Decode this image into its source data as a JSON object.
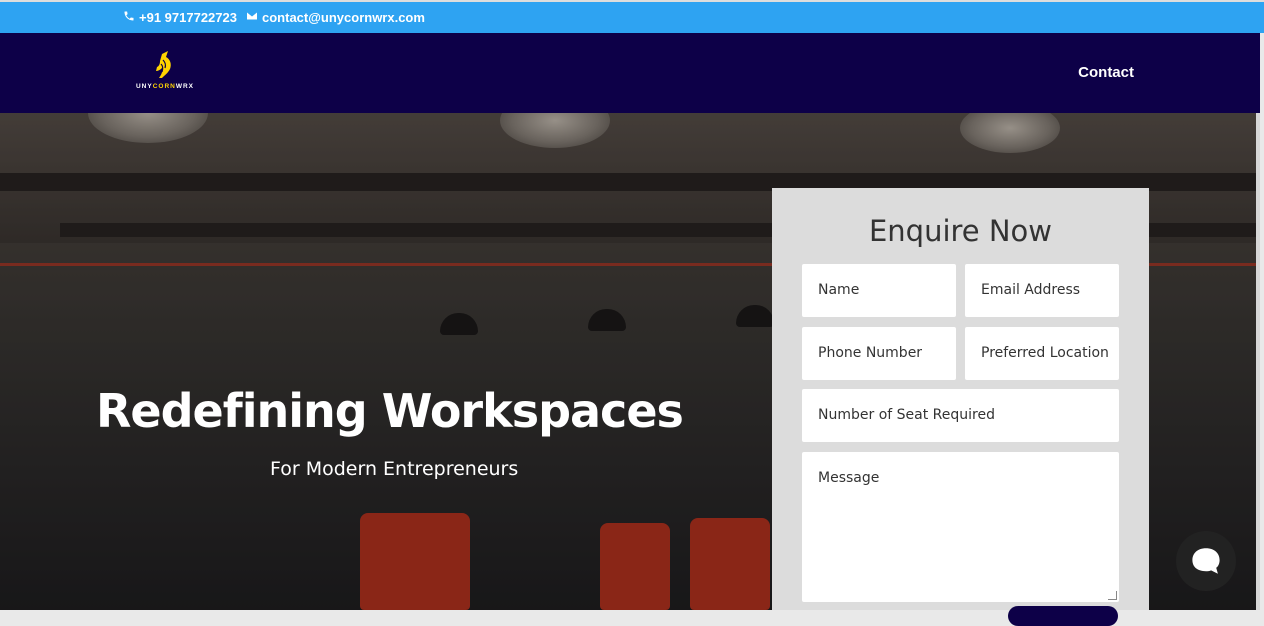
{
  "topbar": {
    "phone": "+91 9717722723",
    "email": "contact@unycornwrx.com",
    "phone_icon": "phone-icon",
    "email_icon": "envelope-icon",
    "bg_color": "#2ea3f2"
  },
  "nav": {
    "logo_text_a": "UNY",
    "logo_text_b": "CORN",
    "logo_text_c": "WRX",
    "logo_icon": "unicorn-logo-icon",
    "contact_label": "Contact",
    "bg_color": "#0d0048"
  },
  "hero": {
    "headline": "Redefining Workspaces",
    "subheadline": "For Modern Entrepreneurs"
  },
  "form": {
    "title": "Enquire Now",
    "name_placeholder": "Name",
    "email_placeholder": "Email Address",
    "phone_placeholder": "Phone Number",
    "location_placeholder": "Preferred Location",
    "seats_placeholder": "Number of Seat Required",
    "message_placeholder": "Message"
  },
  "chat": {
    "icon": "chat-bubble-icon"
  }
}
